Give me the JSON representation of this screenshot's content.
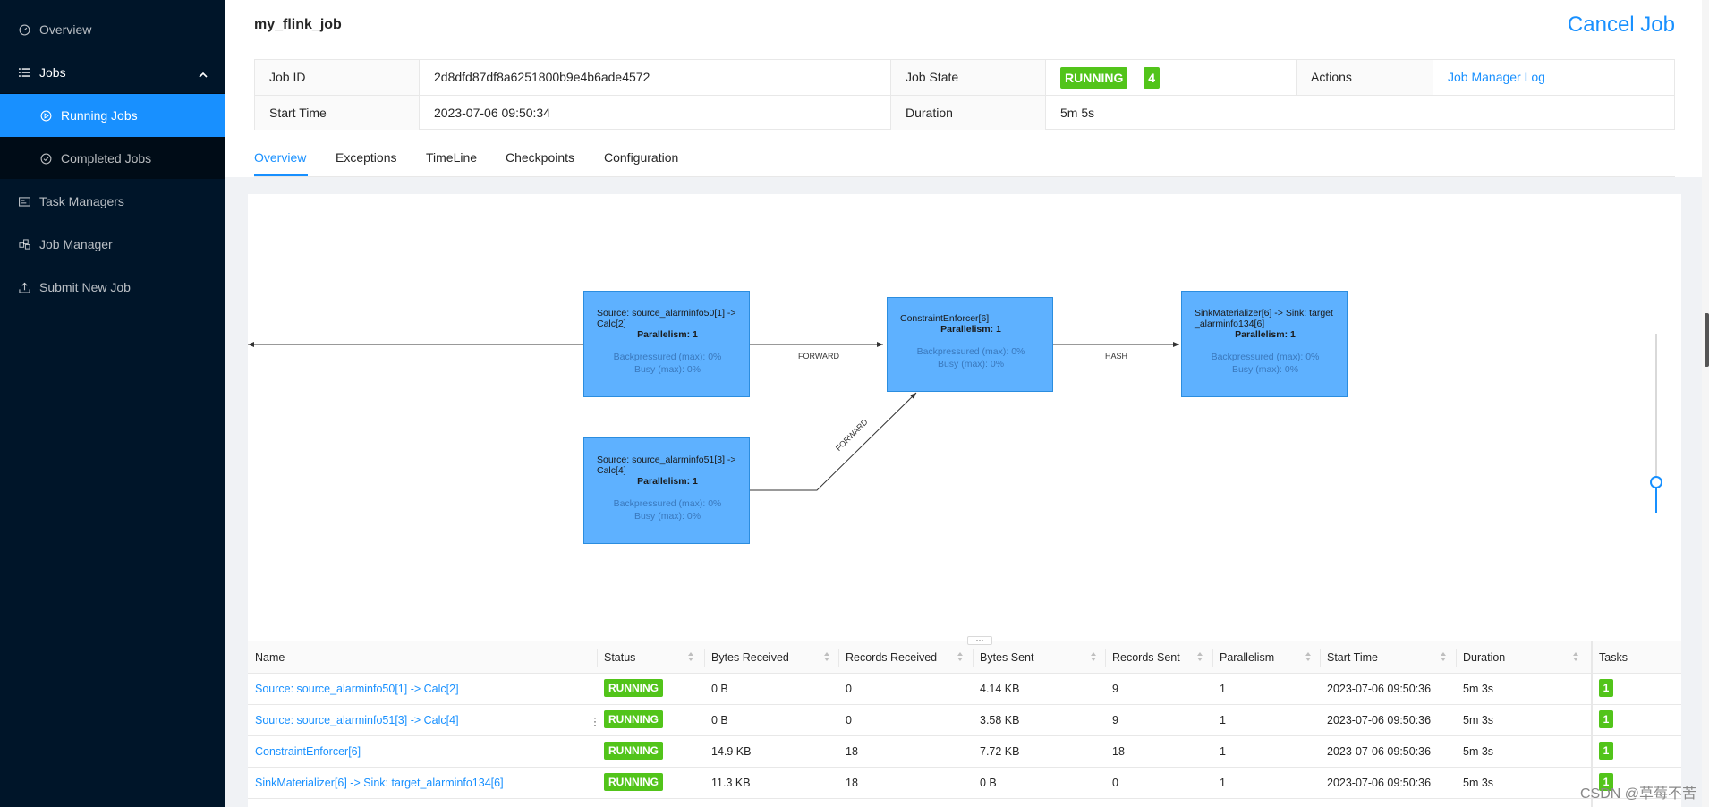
{
  "sidebar": {
    "items": [
      {
        "label": "Overview",
        "icon": "dashboard-icon"
      },
      {
        "label": "Jobs",
        "icon": "list-icon"
      },
      {
        "label": "Running Jobs",
        "icon": "play-circle-icon"
      },
      {
        "label": "Completed Jobs",
        "icon": "check-circle-icon"
      },
      {
        "label": "Task Managers",
        "icon": "schedule-icon"
      },
      {
        "label": "Job Manager",
        "icon": "build-icon"
      },
      {
        "label": "Submit New Job",
        "icon": "upload-icon"
      }
    ]
  },
  "header": {
    "job_name": "my_flink_job",
    "cancel_label": "Cancel Job"
  },
  "info": {
    "job_id_label": "Job ID",
    "job_id": "2d8dfd87df8a6251800b9e4b6ade4572",
    "job_state_label": "Job State",
    "job_state": "RUNNING",
    "running_count": "4",
    "actions_label": "Actions",
    "actions_link": "Job Manager Log",
    "start_time_label": "Start Time",
    "start_time": "2023-07-06 09:50:34",
    "duration_label": "Duration",
    "duration": "5m 5s"
  },
  "tabs": [
    "Overview",
    "Exceptions",
    "TimeLine",
    "Checkpoints",
    "Configuration"
  ],
  "graph": {
    "nodes": [
      {
        "title": "Source: source_alarminfo50[1] -> Calc[2]",
        "parallelism": "Parallelism: 1",
        "backpressure": "Backpressured (max): 0%",
        "busy": "Busy (max): 0%"
      },
      {
        "title": "Source: source_alarminfo51[3] -> Calc[4]",
        "parallelism": "Parallelism: 1",
        "backpressure": "Backpressured (max): 0%",
        "busy": "Busy (max): 0%"
      },
      {
        "title": "ConstraintEnforcer[6]",
        "parallelism": "Parallelism: 1",
        "backpressure": "Backpressured (max): 0%",
        "busy": "Busy (max): 0%"
      },
      {
        "title": "SinkMaterializer[6] -> Sink: target_alarminfo134[6]",
        "parallelism": "Parallelism: 1",
        "backpressure": "Backpressured (max): 0%",
        "busy": "Busy (max): 0%"
      }
    ],
    "edges": [
      "FORWARD",
      "FORWARD",
      "HASH"
    ]
  },
  "table": {
    "headers": [
      "Name",
      "Status",
      "Bytes Received",
      "Records Received",
      "Bytes Sent",
      "Records Sent",
      "Parallelism",
      "Start Time",
      "Duration",
      "Tasks"
    ],
    "rows": [
      {
        "name": "Source: source_alarminfo50[1] -> Calc[2]",
        "status": "RUNNING",
        "bytes_received": "0 B",
        "records_received": "0",
        "bytes_sent": "4.14 KB",
        "records_sent": "9",
        "parallelism": "1",
        "start_time": "2023-07-06 09:50:36",
        "duration": "5m 3s",
        "tasks": "1"
      },
      {
        "name": "Source: source_alarminfo51[3] -> Calc[4]",
        "status": "RUNNING",
        "bytes_received": "0 B",
        "records_received": "0",
        "bytes_sent": "3.58 KB",
        "records_sent": "9",
        "parallelism": "1",
        "start_time": "2023-07-06 09:50:36",
        "duration": "5m 3s",
        "tasks": "1"
      },
      {
        "name": "ConstraintEnforcer[6]",
        "status": "RUNNING",
        "bytes_received": "14.9 KB",
        "records_received": "18",
        "bytes_sent": "7.72 KB",
        "records_sent": "18",
        "parallelism": "1",
        "start_time": "2023-07-06 09:50:36",
        "duration": "5m 3s",
        "tasks": "1"
      },
      {
        "name": "SinkMaterializer[6] -> Sink: target_alarminfo134[6]",
        "status": "RUNNING",
        "bytes_received": "11.3 KB",
        "records_received": "18",
        "bytes_sent": "0 B",
        "records_sent": "0",
        "parallelism": "1",
        "start_time": "2023-07-06 09:50:36",
        "duration": "5m 3s",
        "tasks": "1"
      }
    ]
  },
  "watermark": "CSDN @草莓不苦",
  "colors": {
    "accent": "#1890ff",
    "sidebar": "#001529",
    "running": "#52c41a",
    "node": "#5eb1ff"
  }
}
